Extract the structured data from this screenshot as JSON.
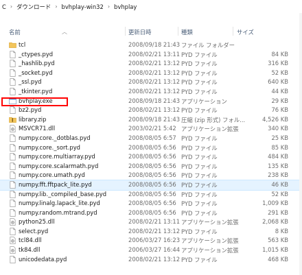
{
  "breadcrumb": {
    "lead": "C",
    "segments": [
      "ダウンロード",
      "bvhplay-win32",
      "bvhplay"
    ]
  },
  "columns": {
    "name": "名前",
    "date": "更新日時",
    "type": "種類",
    "size": "サイズ"
  },
  "files": [
    {
      "name": "tcl",
      "date": "2008/09/18 21:43",
      "type": "ファイル フォルダー",
      "size": "",
      "icon": "folder-icon"
    },
    {
      "name": "_ctypes.pyd",
      "date": "2008/02/21 13:11",
      "type": "PYD ファイル",
      "size": "84 KB",
      "icon": "file-icon"
    },
    {
      "name": "_hashlib.pyd",
      "date": "2008/02/21 13:12",
      "type": "PYD ファイル",
      "size": "316 KB",
      "icon": "file-icon"
    },
    {
      "name": "_socket.pyd",
      "date": "2008/02/21 13:12",
      "type": "PYD ファイル",
      "size": "52 KB",
      "icon": "file-icon"
    },
    {
      "name": "_ssl.pyd",
      "date": "2008/02/21 13:12",
      "type": "PYD ファイル",
      "size": "640 KB",
      "icon": "file-icon"
    },
    {
      "name": "_tkinter.pyd",
      "date": "2008/02/21 13:12",
      "type": "PYD ファイル",
      "size": "44 KB",
      "icon": "file-icon"
    },
    {
      "name": "bvhplay.exe",
      "date": "2008/09/18 21:43",
      "type": "アプリケーション",
      "size": "29 KB",
      "icon": "exe-icon"
    },
    {
      "name": "bz2.pyd",
      "date": "2008/02/21 13:12",
      "type": "PYD ファイル",
      "size": "76 KB",
      "icon": "file-icon"
    },
    {
      "name": "library.zip",
      "date": "2008/09/18 21:43",
      "type": "圧縮 (zip 形式) フォル...",
      "size": "4,526 KB",
      "icon": "zip-icon"
    },
    {
      "name": "MSVCR71.dll",
      "date": "2003/02/21 5:42",
      "type": "アプリケーション拡張",
      "size": "340 KB",
      "icon": "dll-icon"
    },
    {
      "name": "numpy.core._dotblas.pyd",
      "date": "2008/08/05 6:57",
      "type": "PYD ファイル",
      "size": "25 KB",
      "icon": "file-icon"
    },
    {
      "name": "numpy.core._sort.pyd",
      "date": "2008/08/05 6:56",
      "type": "PYD ファイル",
      "size": "85 KB",
      "icon": "file-icon"
    },
    {
      "name": "numpy.core.multiarray.pyd",
      "date": "2008/08/05 6:56",
      "type": "PYD ファイル",
      "size": "484 KB",
      "icon": "file-icon"
    },
    {
      "name": "numpy.core.scalarmath.pyd",
      "date": "2008/08/05 6:56",
      "type": "PYD ファイル",
      "size": "135 KB",
      "icon": "file-icon"
    },
    {
      "name": "numpy.core.umath.pyd",
      "date": "2008/08/05 6:56",
      "type": "PYD ファイル",
      "size": "238 KB",
      "icon": "file-icon"
    },
    {
      "name": "numpy.fft.fftpack_lite.pyd",
      "date": "2008/08/05 6:56",
      "type": "PYD ファイル",
      "size": "46 KB",
      "icon": "file-icon"
    },
    {
      "name": "numpy.lib._compiled_base.pyd",
      "date": "2008/08/05 6:56",
      "type": "PYD ファイル",
      "size": "52 KB",
      "icon": "file-icon"
    },
    {
      "name": "numpy.linalg.lapack_lite.pyd",
      "date": "2008/08/05 6:56",
      "type": "PYD ファイル",
      "size": "1,009 KB",
      "icon": "file-icon"
    },
    {
      "name": "numpy.random.mtrand.pyd",
      "date": "2008/08/05 6:56",
      "type": "PYD ファイル",
      "size": "291 KB",
      "icon": "file-icon"
    },
    {
      "name": "python25.dll",
      "date": "2008/02/21 13:11",
      "type": "アプリケーション拡張",
      "size": "2,068 KB",
      "icon": "dll-icon"
    },
    {
      "name": "select.pyd",
      "date": "2008/02/21 13:12",
      "type": "PYD ファイル",
      "size": "8 KB",
      "icon": "file-icon"
    },
    {
      "name": "tcl84.dll",
      "date": "2006/03/27 16:23",
      "type": "アプリケーション拡張",
      "size": "563 KB",
      "icon": "dll-icon"
    },
    {
      "name": "tk84.dll",
      "date": "2006/03/27 16:44",
      "type": "アプリケーション拡張",
      "size": "1,015 KB",
      "icon": "dll-icon"
    },
    {
      "name": "unicodedata.pyd",
      "date": "2008/02/21 13:12",
      "type": "PYD ファイル",
      "size": "468 KB",
      "icon": "file-icon"
    }
  ],
  "selected_index": 15,
  "highlighted_index": 6,
  "colors": {
    "selection": "#e5f3ff",
    "highlight_box": "#ff0000",
    "folder": "#e8b84a"
  }
}
